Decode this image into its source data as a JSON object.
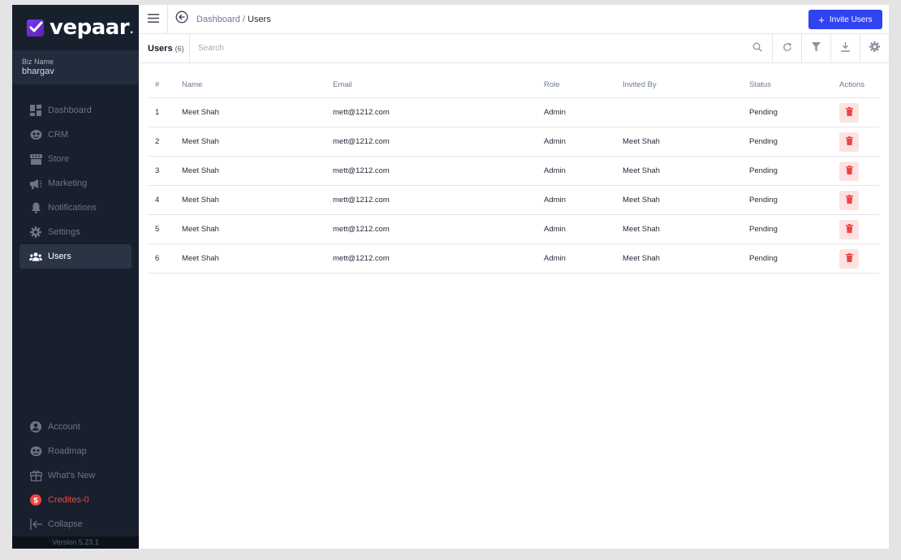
{
  "brand": {
    "name": "vepaar",
    "dot": "."
  },
  "biz": {
    "label": "Biz Name",
    "name": "bhargav"
  },
  "nav": {
    "items": [
      {
        "label": "Dashboard",
        "icon": "dashboard-icon"
      },
      {
        "label": "CRM",
        "icon": "crm-icon"
      },
      {
        "label": "Store",
        "icon": "store-icon"
      },
      {
        "label": "Marketing",
        "icon": "megaphone-icon"
      },
      {
        "label": "Notifications",
        "icon": "bell-icon"
      },
      {
        "label": "Settings",
        "icon": "gear-icon"
      },
      {
        "label": "Users",
        "icon": "users-icon",
        "active": true
      }
    ],
    "bottom": [
      {
        "label": "Account",
        "icon": "account-icon"
      },
      {
        "label": "Roadmap",
        "icon": "roadmap-icon"
      },
      {
        "label": "What's New",
        "icon": "gift-icon"
      },
      {
        "label": "Credites-0",
        "icon": "credits-icon"
      },
      {
        "label": "Collapse",
        "icon": "collapse-icon"
      }
    ],
    "version": "Version 5.23.1"
  },
  "header": {
    "breadcrumb_parent": "Dashboard",
    "breadcrumb_sep": " / ",
    "breadcrumb_current": "Users",
    "invite_label": "Invite Users"
  },
  "toolbar": {
    "tab_label": "Users",
    "tab_count": "(6)",
    "search_placeholder": "Search"
  },
  "table": {
    "columns": [
      "#",
      "Name",
      "Email",
      "Role",
      "Invited By",
      "Status",
      "Actions"
    ],
    "rows": [
      {
        "num": "1",
        "name": "Meet Shah",
        "email": "mett@1212.com",
        "role": "Admin",
        "invited_by": "",
        "status": "Pending"
      },
      {
        "num": "2",
        "name": "Meet Shah",
        "email": "mett@1212.com",
        "role": "Admin",
        "invited_by": "Meet Shah",
        "status": "Pending"
      },
      {
        "num": "3",
        "name": "Meet Shah",
        "email": "mett@1212.com",
        "role": "Admin",
        "invited_by": "Meet Shah",
        "status": "Pending"
      },
      {
        "num": "4",
        "name": "Meet Shah",
        "email": "mett@1212.com",
        "role": "Admin",
        "invited_by": "Meet Shah",
        "status": "Pending"
      },
      {
        "num": "5",
        "name": "Meet Shah",
        "email": "mett@1212.com",
        "role": "Admin",
        "invited_by": "Meet Shah",
        "status": "Pending"
      },
      {
        "num": "6",
        "name": "Meet Shah",
        "email": "mett@1212.com",
        "role": "Admin",
        "invited_by": "Meet Shah",
        "status": "Pending"
      }
    ]
  },
  "colors": {
    "sidebar_bg": "#18202e",
    "accent": "#2f43f1",
    "danger": "#ef4444",
    "danger_bg": "#fde2e2"
  }
}
